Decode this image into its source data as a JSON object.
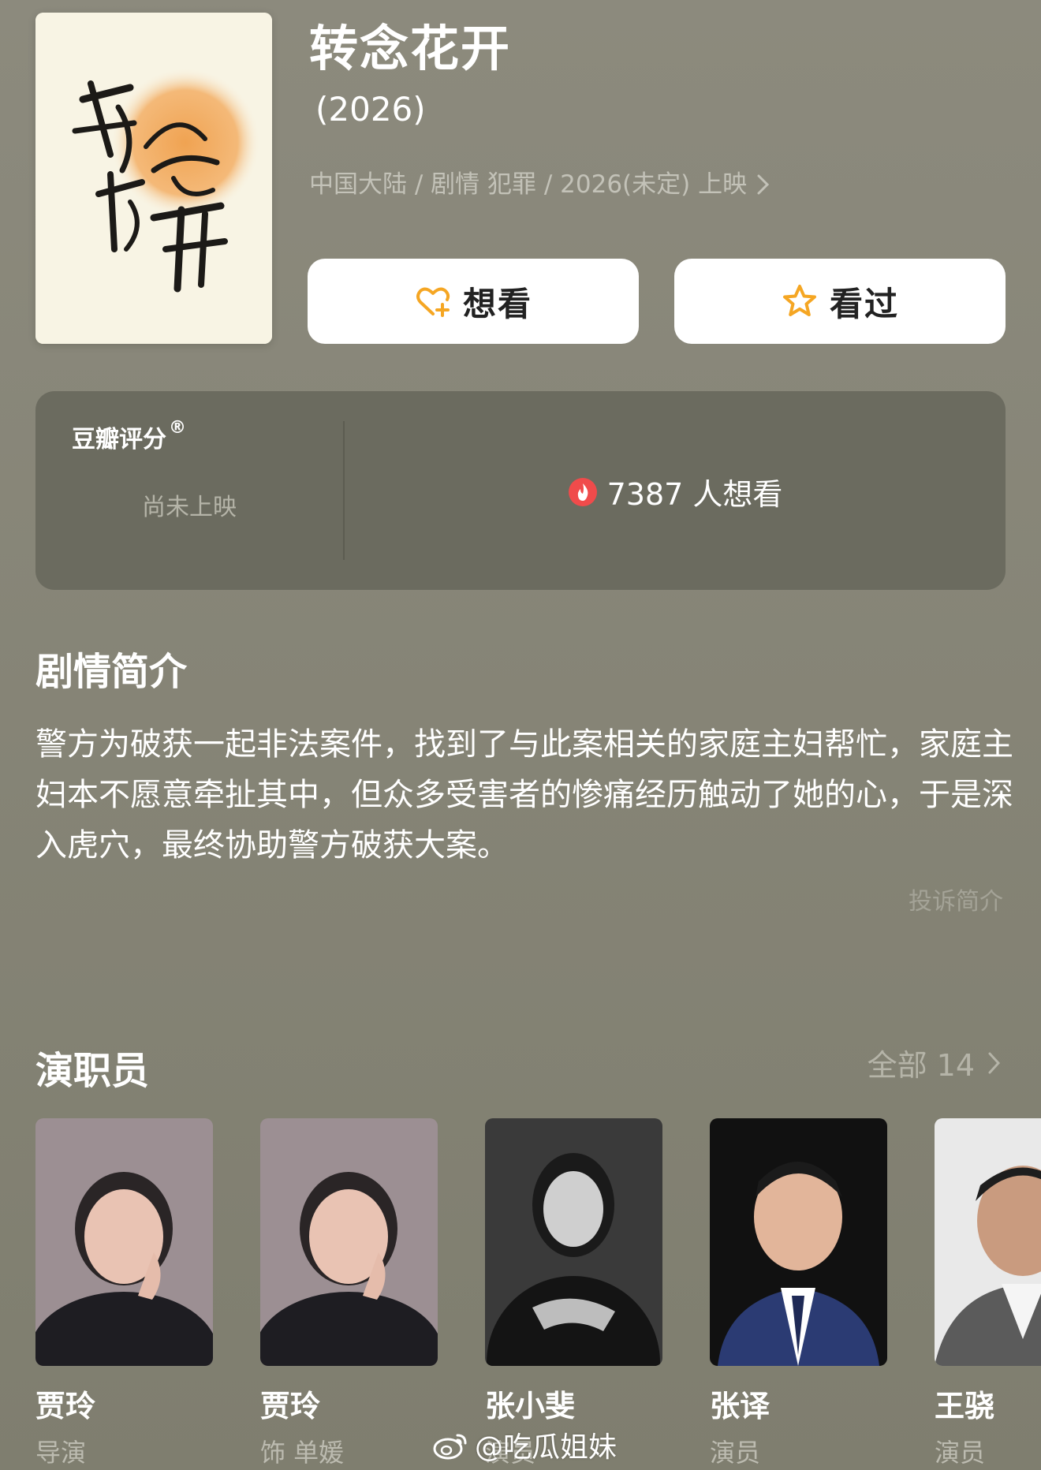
{
  "movie": {
    "title": "转念花开",
    "year": "(2026)",
    "meta": "中国大陆 / 剧情 犯罪 / 2026(未定) 上映",
    "poster_title_art": "转念花开"
  },
  "actions": {
    "want_label": "想看",
    "seen_label": "看过"
  },
  "rating": {
    "label": "豆瓣评分",
    "registered_mark": "®",
    "status": "尚未上映",
    "want_count_text": "7387 人想看"
  },
  "synopsis": {
    "title": "剧情简介",
    "text": "警方为破获一起非法案件，找到了与此案相关的家庭主妇帮忙，家庭主妇本不愿意牵扯其中，但众多受害者的惨痛经历触动了她的心，于是深入虎穴，最终协助警方破获大案。",
    "report_label": "投诉简介"
  },
  "cast": {
    "title": "演职员",
    "all_label": "全部 14",
    "members": [
      {
        "name": "贾玲",
        "role": "导演"
      },
      {
        "name": "贾玲",
        "role": "饰 单媛"
      },
      {
        "name": "张小斐",
        "role": "演员"
      },
      {
        "name": "张译",
        "role": "演员"
      },
      {
        "name": "王骁",
        "role": "演员"
      }
    ]
  },
  "watermark": {
    "text": "@吃瓜姐妹"
  },
  "colors": {
    "background": "#858474",
    "card": "#6b6b5f",
    "accent_orange": "#f5a623",
    "hot_red": "#f04b4b"
  },
  "icons": [
    "heart-plus-icon",
    "star-icon",
    "fire-icon",
    "chevron-right-icon",
    "weibo-icon"
  ]
}
